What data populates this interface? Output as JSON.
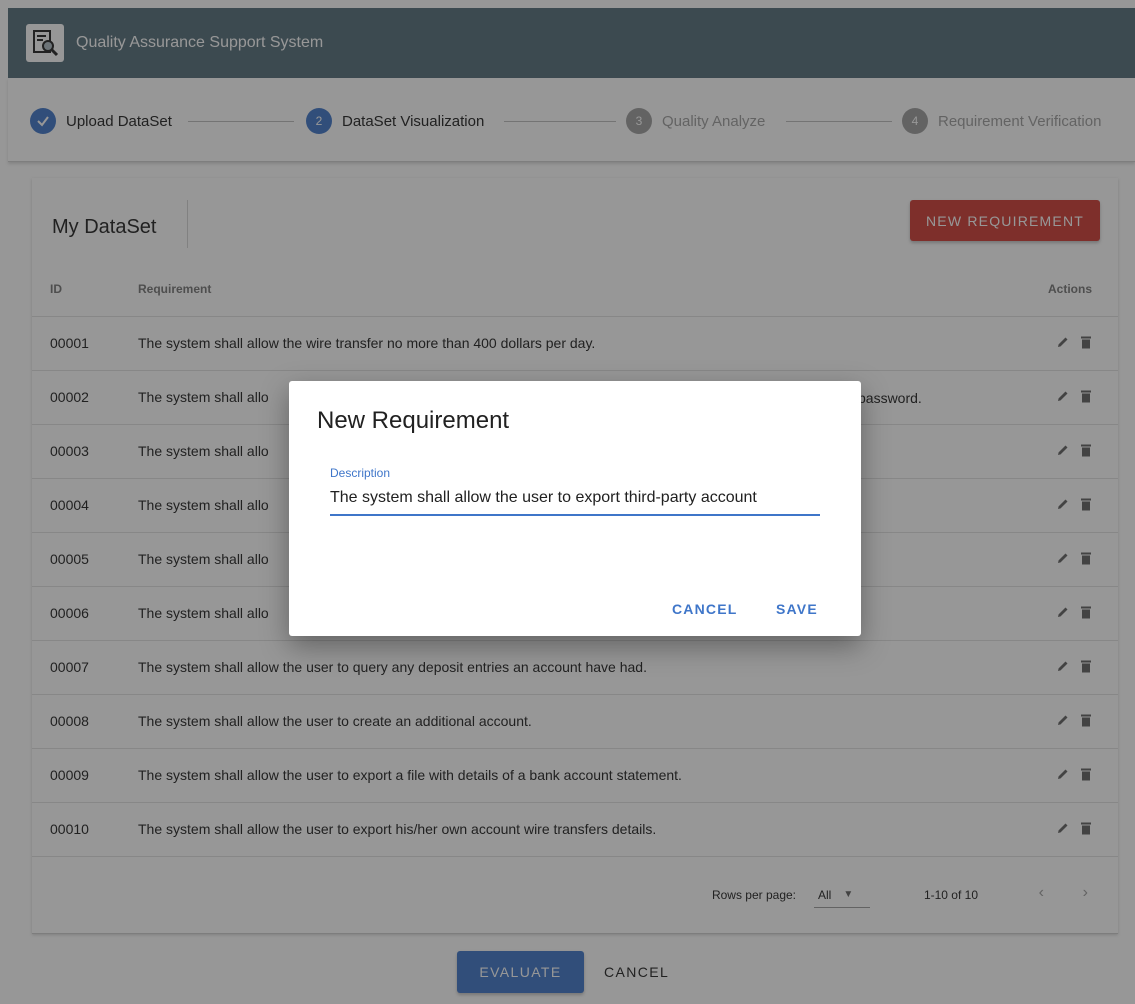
{
  "app": {
    "title": "Quality Assurance Support System",
    "logo_icon": "document-search-icon"
  },
  "stepper": {
    "steps": [
      {
        "number": "",
        "label": "Upload DataSet",
        "state": "done"
      },
      {
        "number": "2",
        "label": "DataSet Visualization",
        "state": "active"
      },
      {
        "number": "3",
        "label": "Quality Analyze",
        "state": "todo"
      },
      {
        "number": "4",
        "label": "Requirement Verification",
        "state": "todo"
      }
    ]
  },
  "dataset": {
    "title": "My DataSet",
    "new_button": "NEW REQUIREMENT",
    "columns": {
      "id": "ID",
      "requirement": "Requirement",
      "actions": "Actions"
    },
    "rows": [
      {
        "id": "00001",
        "text": "The system shall allow the wire transfer no more than 400 dollars per day."
      },
      {
        "id": "00002",
        "text": "The system shall allo",
        "tail": "password."
      },
      {
        "id": "00003",
        "text": "The system shall allo"
      },
      {
        "id": "00004",
        "text": "The system shall allo"
      },
      {
        "id": "00005",
        "text": "The system shall allo"
      },
      {
        "id": "00006",
        "text": "The system shall allo"
      },
      {
        "id": "00007",
        "text": "The system shall allow the user to query any deposit entries an account have had."
      },
      {
        "id": "00008",
        "text": "The system shall allow the user to create an additional account."
      },
      {
        "id": "00009",
        "text": "The system shall allow the user to export a file with details of a bank account statement."
      },
      {
        "id": "00010",
        "text": "The system shall allow the user to export his/her own account wire transfers details."
      }
    ],
    "footer": {
      "rows_per_page_label": "Rows per page:",
      "rows_per_page_value": "All",
      "range": "1-10 of 10",
      "prev": "‹",
      "next": "›"
    }
  },
  "bottom": {
    "evaluate": "EVALUATE",
    "cancel": "CANCEL"
  },
  "dialog": {
    "title": "New Requirement",
    "field_label": "Description",
    "field_value": "The system shall allow the user to export third-party account",
    "cancel": "CANCEL",
    "save": "SAVE"
  },
  "colors": {
    "appbar": "#546e7a",
    "primary": "#3f76c9",
    "accent": "#d03b34"
  }
}
